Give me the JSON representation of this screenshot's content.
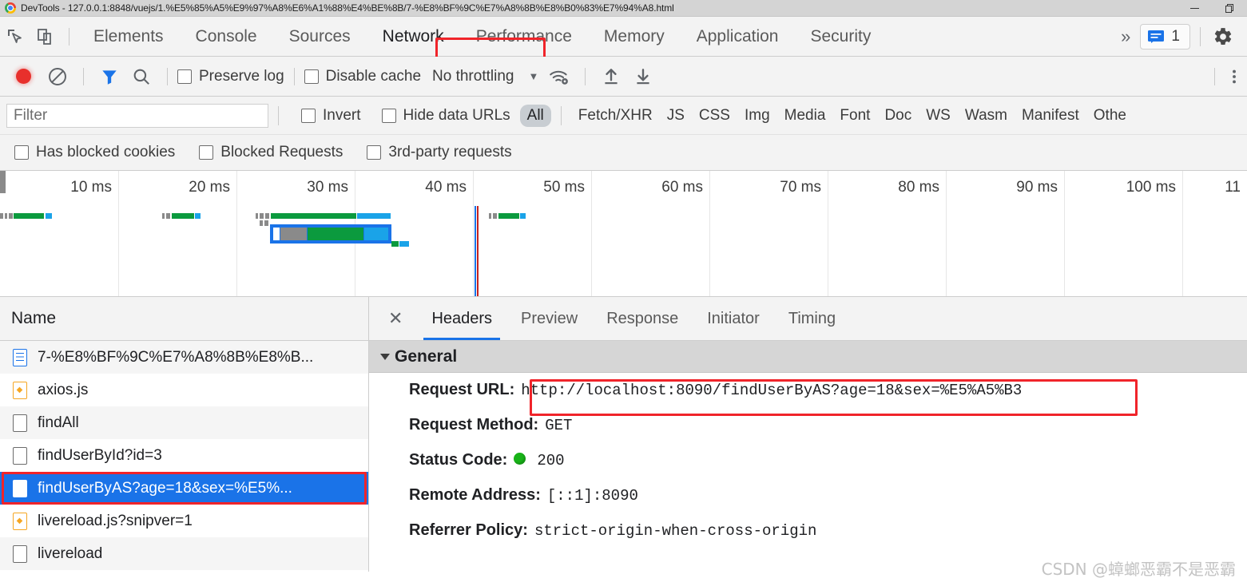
{
  "window": {
    "title": "DevTools - 127.0.0.1:8848/vuejs/1.%E5%85%A5%E9%97%A8%E6%A1%88%E4%BE%8B/7-%E8%BF%9C%E7%A8%8B%E8%B0%83%E7%94%A8.html",
    "logo_icon": "chrome-logo-icon",
    "minimize_label": "–",
    "maximize_label": "❐"
  },
  "toolbar": {
    "inspect_icon": "inspect-element-icon",
    "device_icon": "device-toolbar-icon",
    "tabs": [
      {
        "label": "Elements",
        "active": false
      },
      {
        "label": "Console",
        "active": false
      },
      {
        "label": "Sources",
        "active": false
      },
      {
        "label": "Network",
        "active": true,
        "highlighted": true
      },
      {
        "label": "Performance",
        "active": false
      },
      {
        "label": "Memory",
        "active": false
      },
      {
        "label": "Application",
        "active": false
      },
      {
        "label": "Security",
        "active": false
      }
    ],
    "more_label": "»",
    "messages_count": "1",
    "messages_icon": "message-bubble-icon",
    "settings_icon": "gear-icon"
  },
  "network_toolbar": {
    "record_icon": "record-button-icon",
    "clear_icon": "clear-icon",
    "filter_icon": "filter-funnel-icon",
    "search_icon": "search-icon",
    "preserve_log_label": "Preserve log",
    "preserve_log_checked": false,
    "disable_cache_label": "Disable cache",
    "disable_cache_checked": false,
    "throttling_label": "No throttling",
    "throttling_caret": "▼",
    "network_conditions_icon": "wifi-settings-icon",
    "import_icon": "import-har-icon",
    "export_icon": "export-har-icon"
  },
  "filter_bar": {
    "filter_placeholder": "Filter",
    "filter_value": "",
    "invert_label": "Invert",
    "invert_checked": false,
    "hide_data_urls_label": "Hide data URLs",
    "hide_data_urls_checked": false,
    "types": [
      {
        "label": "All",
        "selected": true
      },
      {
        "label": "Fetch/XHR",
        "selected": false
      },
      {
        "label": "JS",
        "selected": false
      },
      {
        "label": "CSS",
        "selected": false
      },
      {
        "label": "Img",
        "selected": false
      },
      {
        "label": "Media",
        "selected": false
      },
      {
        "label": "Font",
        "selected": false
      },
      {
        "label": "Doc",
        "selected": false
      },
      {
        "label": "WS",
        "selected": false
      },
      {
        "label": "Wasm",
        "selected": false
      },
      {
        "label": "Manifest",
        "selected": false
      },
      {
        "label": "Othe",
        "selected": false
      }
    ]
  },
  "option_bar": {
    "options": [
      {
        "label": "Has blocked cookies",
        "checked": false
      },
      {
        "label": "Blocked Requests",
        "checked": false
      },
      {
        "label": "3rd-party requests",
        "checked": false
      }
    ]
  },
  "overview": {
    "ticks": [
      "10 ms",
      "20 ms",
      "30 ms",
      "40 ms",
      "50 ms",
      "60 ms",
      "70 ms",
      "80 ms",
      "90 ms",
      "100 ms",
      "11"
    ]
  },
  "requests": {
    "column_header": "Name",
    "rows": [
      {
        "name": "7-%E8%BF%9C%E7%A8%8B%E8%B...",
        "icon": "document-icon",
        "selected": false
      },
      {
        "name": "axios.js",
        "icon": "js-file-icon",
        "selected": false
      },
      {
        "name": "findAll",
        "icon": "generic-file-icon",
        "selected": false
      },
      {
        "name": "findUserById?id=3",
        "icon": "generic-file-icon",
        "selected": false
      },
      {
        "name": "findUserByAS?age=18&sex=%E5%...",
        "icon": "generic-file-icon",
        "selected": true,
        "highlighted": true
      },
      {
        "name": "livereload.js?snipver=1",
        "icon": "js-file-icon",
        "selected": false
      },
      {
        "name": "livereload",
        "icon": "generic-file-icon",
        "selected": false
      }
    ]
  },
  "details": {
    "close_icon": "close-icon",
    "tabs": [
      {
        "label": "Headers",
        "active": true
      },
      {
        "label": "Preview",
        "active": false
      },
      {
        "label": "Response",
        "active": false
      },
      {
        "label": "Initiator",
        "active": false
      },
      {
        "label": "Timing",
        "active": false
      }
    ],
    "general": {
      "section_title": "General",
      "expanded": true,
      "fields": [
        {
          "key": "Request URL:",
          "value": "http://localhost:8090/findUserByAS?age=18&sex=%E5%A5%B3",
          "highlighted": true
        },
        {
          "key": "Request Method:",
          "value": "GET",
          "highlighted": false
        },
        {
          "key": "Status Code:",
          "value": "200",
          "status_dot": "#18b318",
          "highlighted": false
        },
        {
          "key": "Remote Address:",
          "value": "[::1]:8090",
          "highlighted": false
        },
        {
          "key": "Referrer Policy:",
          "value": "strict-origin-when-cross-origin",
          "highlighted": false
        }
      ]
    }
  },
  "watermark": {
    "text": "CSDN @蟑螂恶霸不是恶霸"
  },
  "colors": {
    "accent": "#1a73e8",
    "annotation": "#f0242a",
    "record": "#e8302c",
    "status_ok": "#18b318",
    "waterfall_green": "#0b9a3e",
    "waterfall_cyan": "#1aa3e8",
    "waterfall_gray": "#8a8a8a"
  }
}
